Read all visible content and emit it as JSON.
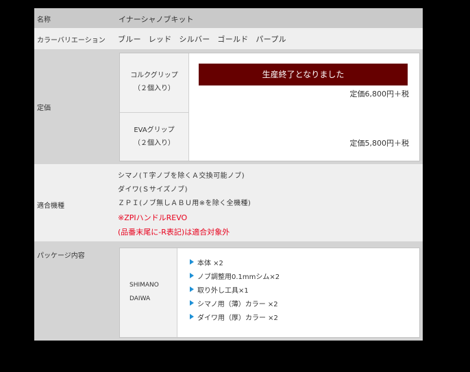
{
  "spec": {
    "name": {
      "label": "名称",
      "value": "イナーシャノブキット"
    },
    "colors": {
      "label": "カラーバリエーション",
      "value": "ブルー レッド シルバー ゴールド パープル"
    },
    "price": {
      "label": "定価",
      "discontinued_label": "生産終了となりました",
      "items": [
        {
          "grip": "コルクグリップ",
          "qty": "（２個入り）",
          "price": "定価6,800円＋税"
        },
        {
          "grip": "EVAグリップ",
          "qty": "（２個入り）",
          "price": "定価5,800円＋税"
        }
      ]
    },
    "compatible": {
      "label": "適合機種",
      "lines": [
        "シマノ(Ｔ字ノブを除くＡ交換可能ノブ)",
        "ダイワ(Ｓサイズノブ)",
        "ＺＰＩ(ノブ無しＡＢＵ用※を除く全機種)"
      ],
      "notes": [
        "※ZPIハンドルREVO",
        "(品番末尾に-R表記)は適合対象外"
      ],
      "note_color": "#e8001c"
    },
    "package": {
      "label": "パッケージ内容",
      "brands": [
        "SHIMANO",
        "DAIWA"
      ],
      "items": [
        "本体 ×2",
        "ノブ調整用0.1mmシム×2",
        "取り外し工具×1",
        "シマノ用（薄）カラー ×2",
        "ダイワ用（厚）カラー ×2"
      ],
      "bullet_icon": "triangle-right-icon",
      "bullet_color": "#1e90d6"
    }
  }
}
